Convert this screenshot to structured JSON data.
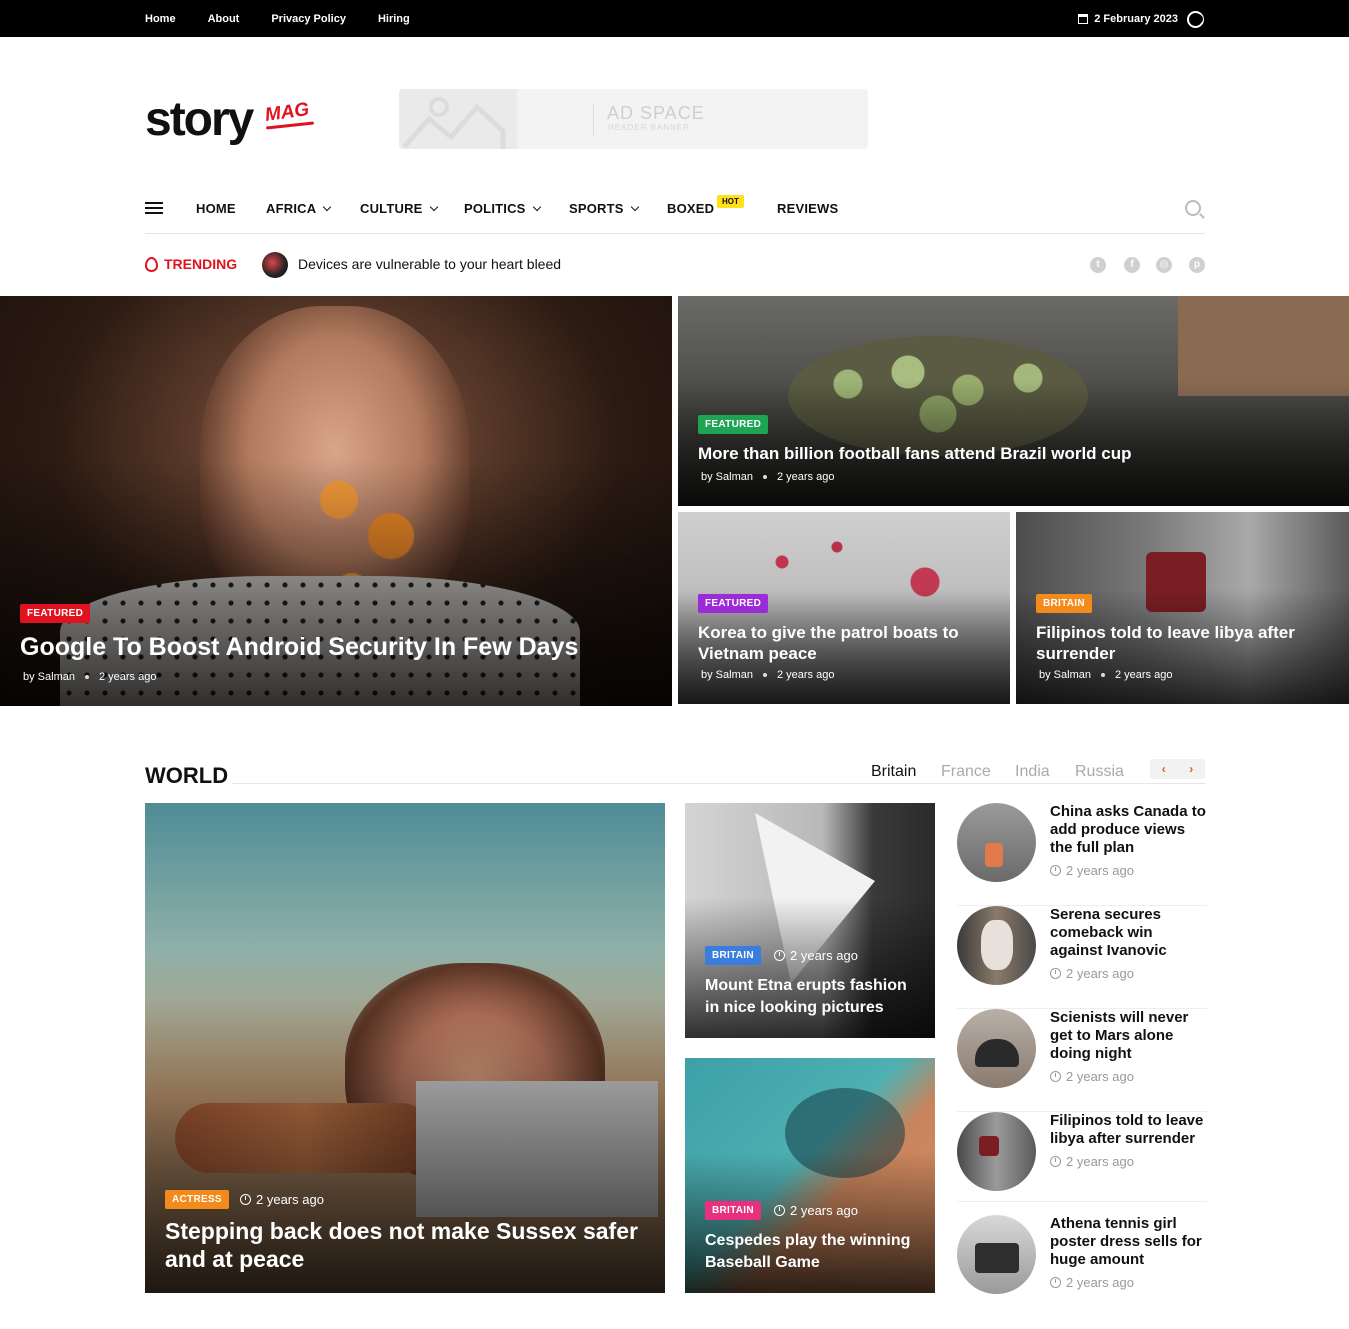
{
  "topbar": {
    "links": [
      "Home",
      "About",
      "Privacy Policy",
      "Hiring"
    ],
    "date": "2 February 2023"
  },
  "logo": {
    "main": "story",
    "sub": "MAG"
  },
  "ad": {
    "title": "AD SPACE",
    "subtitle": "HEADER BANNER"
  },
  "nav": {
    "items": [
      "HOME",
      "AFRICA",
      "CULTURE",
      "POLITICS",
      "SPORTS",
      "BOXED",
      "REVIEWS"
    ],
    "hot_badge": "HOT"
  },
  "trending": {
    "label": "TRENDING",
    "headline": "Devices are vulnerable to your heart bleed"
  },
  "hero": {
    "main": {
      "badge": "FEATURED",
      "title": "Google To Boost Android Security In Few Days",
      "author": "by Salman",
      "time": "2 years ago"
    },
    "top_right": {
      "badge": "FEATURED",
      "title": "More than billion football fans attend Brazil world cup",
      "author": "by Salman",
      "time": "2 years ago"
    },
    "bottom_left": {
      "badge": "FEATURED",
      "title": "Korea to give the patrol boats to Vietnam peace",
      "author": "by Salman",
      "time": "2 years ago"
    },
    "bottom_right": {
      "badge": "BRITAIN",
      "title": "Filipinos told to leave libya after surrender",
      "author": "by Salman",
      "time": "2 years ago"
    }
  },
  "world": {
    "title": "WORLD",
    "tabs": [
      "Britain",
      "France",
      "India",
      "Russia"
    ],
    "big": {
      "badge": "ACTRESS",
      "time": "2 years ago",
      "title": "Stepping back does not make Sussex safer and at peace"
    },
    "mid1": {
      "badge": "BRITAIN",
      "time": "2 years ago",
      "title": "Mount Etna erupts fashion in nice looking pictures"
    },
    "mid2": {
      "badge": "BRITAIN",
      "time": "2 years ago",
      "title": "Cespedes play the winning Baseball Game"
    },
    "list": [
      {
        "title": "China asks Canada to add produce views the full plan",
        "time": "2 years ago"
      },
      {
        "title": "Serena secures comeback win against Ivanovic",
        "time": "2 years ago"
      },
      {
        "title": "Scienists will never get to Mars alone doing night",
        "time": "2 years ago"
      },
      {
        "title": "Filipinos told to leave libya after surrender",
        "time": "2 years ago"
      },
      {
        "title": "Athena tennis girl poster dress sells for huge amount",
        "time": "2 years ago"
      }
    ]
  },
  "colors": {
    "brand_red": "#e1121f",
    "badge_featured_red": "#e1121f",
    "badge_featured_green": "#1ea453",
    "badge_featured_purple": "#9b2bd9",
    "badge_britain_orange": "#f28a1c",
    "badge_britain_blue": "#3b7ddd",
    "badge_britain_pink": "#e8317e",
    "hot_yellow": "#ffe01b"
  }
}
